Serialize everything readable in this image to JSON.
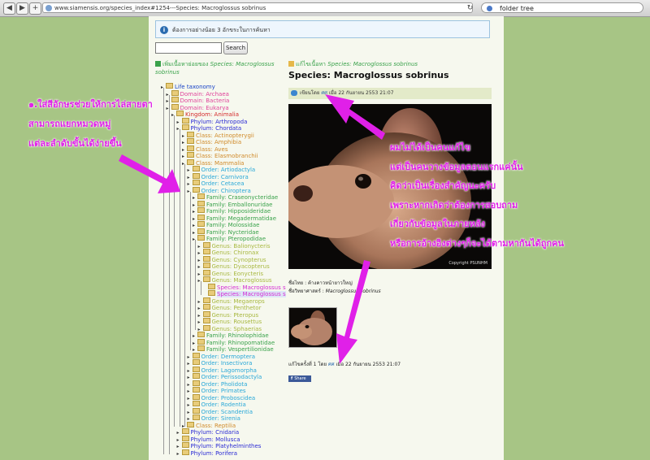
{
  "browser": {
    "url": "www.siamensis.org/species_index#1254---Species: Macroglossus sobrinus",
    "search_value": "folder tree"
  },
  "notice": "ต้องการอย่างน้อย 3 อักขระในการค้นหา",
  "search": {
    "button_label": "Search"
  },
  "left_title": {
    "prefix": "เพิ่มเนื้อหาย่อยของ ",
    "species": "Species: Macroglossus sobrinus"
  },
  "tree": [
    {
      "label": "Life taxonomy",
      "depth": 0,
      "color": "#1a44c8"
    },
    {
      "label": "Domain: Archaea",
      "depth": 1,
      "color": "#e0449a"
    },
    {
      "label": "Domain: Bacteria",
      "depth": 1,
      "color": "#e0449a"
    },
    {
      "label": "Domain: Eukarya",
      "depth": 1,
      "color": "#e0449a"
    },
    {
      "label": "Kingdom: Animalia",
      "depth": 2,
      "color": "#d42b2b"
    },
    {
      "label": "Phylum: Arthropoda",
      "depth": 3,
      "color": "#2a2ad4"
    },
    {
      "label": "Phylum: Chordata",
      "depth": 3,
      "color": "#2a2ad4"
    },
    {
      "label": "Class: Actinopterygii",
      "depth": 4,
      "color": "#d08a2a"
    },
    {
      "label": "Class: Amphibia",
      "depth": 4,
      "color": "#d08a2a"
    },
    {
      "label": "Class: Aves",
      "depth": 4,
      "color": "#d08a2a"
    },
    {
      "label": "Class: Elasmobranchii",
      "depth": 4,
      "color": "#d08a2a"
    },
    {
      "label": "Class: Mammalia",
      "depth": 4,
      "color": "#d08a2a"
    },
    {
      "label": "Order: Artiodactyla",
      "depth": 5,
      "color": "#2aa8d8"
    },
    {
      "label": "Order: Carnivora",
      "depth": 5,
      "color": "#2aa8d8"
    },
    {
      "label": "Order: Cetacea",
      "depth": 5,
      "color": "#2aa8d8"
    },
    {
      "label": "Order: Chiroptera",
      "depth": 5,
      "color": "#2aa8d8"
    },
    {
      "label": "Family: Craseonycteridae",
      "depth": 6,
      "color": "#3aa24b"
    },
    {
      "label": "Family: Emballonuridae",
      "depth": 6,
      "color": "#3aa24b"
    },
    {
      "label": "Family: Hipposideridae",
      "depth": 6,
      "color": "#3aa24b"
    },
    {
      "label": "Family: Megadermatidae",
      "depth": 6,
      "color": "#3aa24b"
    },
    {
      "label": "Family: Molossidae",
      "depth": 6,
      "color": "#3aa24b"
    },
    {
      "label": "Family: Nycteridae",
      "depth": 6,
      "color": "#3aa24b"
    },
    {
      "label": "Family: Pteropodidae",
      "depth": 6,
      "color": "#3aa24b"
    },
    {
      "label": "Genus: Balionycteris",
      "depth": 7,
      "color": "#a8b840"
    },
    {
      "label": "Genus: Chironax",
      "depth": 7,
      "color": "#a8b840"
    },
    {
      "label": "Genus: Cynopterus",
      "depth": 7,
      "color": "#a8b840"
    },
    {
      "label": "Genus: Dyacopterus",
      "depth": 7,
      "color": "#a8b840"
    },
    {
      "label": "Genus: Eonycteris",
      "depth": 7,
      "color": "#a8b840"
    },
    {
      "label": "Genus: Macroglossus",
      "depth": 7,
      "color": "#a8b840"
    },
    {
      "label": "Species: Macroglossus s",
      "depth": 8,
      "color": "#d42bd4"
    },
    {
      "label": "Species: Macroglossus s",
      "depth": 8,
      "color": "#d42bd4",
      "selected": true
    },
    {
      "label": "Genus: Megaerops",
      "depth": 7,
      "color": "#a8b840"
    },
    {
      "label": "Genus: Penthetor",
      "depth": 7,
      "color": "#a8b840"
    },
    {
      "label": "Genus: Pteropus",
      "depth": 7,
      "color": "#a8b840"
    },
    {
      "label": "Genus: Rousettus",
      "depth": 7,
      "color": "#a8b840"
    },
    {
      "label": "Genus: Sphaerias",
      "depth": 7,
      "color": "#a8b840"
    },
    {
      "label": "Family: Rhinolophidae",
      "depth": 6,
      "color": "#3aa24b"
    },
    {
      "label": "Family: Rhinopomatidae",
      "depth": 6,
      "color": "#3aa24b"
    },
    {
      "label": "Family: Vespertilionidae",
      "depth": 6,
      "color": "#3aa24b"
    },
    {
      "label": "Order: Dermoptera",
      "depth": 5,
      "color": "#2aa8d8"
    },
    {
      "label": "Order: Insectivora",
      "depth": 5,
      "color": "#2aa8d8"
    },
    {
      "label": "Order: Lagomorpha",
      "depth": 5,
      "color": "#2aa8d8"
    },
    {
      "label": "Order: Perissodactyla",
      "depth": 5,
      "color": "#2aa8d8"
    },
    {
      "label": "Order: Pholidota",
      "depth": 5,
      "color": "#2aa8d8"
    },
    {
      "label": "Order: Primates",
      "depth": 5,
      "color": "#2aa8d8"
    },
    {
      "label": "Order: Proboscidea",
      "depth": 5,
      "color": "#2aa8d8"
    },
    {
      "label": "Order: Rodentia",
      "depth": 5,
      "color": "#2aa8d8"
    },
    {
      "label": "Order: Scandentia",
      "depth": 5,
      "color": "#2aa8d8"
    },
    {
      "label": "Order: Sirenia",
      "depth": 5,
      "color": "#2aa8d8"
    },
    {
      "label": "Class: Reptilia",
      "depth": 4,
      "color": "#d08a2a"
    },
    {
      "label": "Phylum: Cnidaria",
      "depth": 3,
      "color": "#2a2ad4"
    },
    {
      "label": "Phylum: Mollusca",
      "depth": 3,
      "color": "#2a2ad4"
    },
    {
      "label": "Phylum: Platyhelminthes",
      "depth": 3,
      "color": "#2a2ad4"
    },
    {
      "label": "Phylum: Porifera",
      "depth": 3,
      "color": "#2a2ad4"
    }
  ],
  "content": {
    "edit_prefix": "แก้ไขเนื้อหา ",
    "edit_species": "Species: Macroglossus sobrinus",
    "title": "Species: Macroglossus sobrinus",
    "author_prefix": "เขียนโดย ",
    "author": "ศศ",
    "author_suffix": " เมื่อ 22 กันยายน 2553 21:07",
    "copyright": "Copyright PSUNHM",
    "thai_name": "ชื่อไทย : ค้างคาวหน้ายาวใหญ่",
    "sci_name_label": "ชื่อวิทยาศาสตร์ : ",
    "sci_name": "Macroglossus sobrinus",
    "edited_prefix": "แก้ไขครั้งที่ 1 โดย ",
    "edited_author": "ศศ",
    "edited_suffix": " เมื่อ 22 กันยายน 2553 21:07",
    "share_label": "Share"
  },
  "annotations": {
    "left": [
      "๑.ใส่สีอักษรช่วยให้การไล่สายตา",
      "สามารถแยกหมวดหมู่",
      "แต่ละลำดับขั้นได้ง่ายขึ้น"
    ],
    "right": [
      "ผมไม่ได้เป็นคนแก้ไข",
      "แต่เป็นคนวางข้อมูลตอนแรกแค่นั้น",
      "คิดว่าเป็นเรื่องสำคัญนะครับ",
      "เพราะหากเกิดว่าต้องการสอบถาม",
      "เกี่ยวกับข้อมูลในภายหลัง",
      "หรือการอ้างอิงต่างๆก็จะได้ตามหากันได้ถูกคน"
    ],
    "color": "#e020e8"
  }
}
